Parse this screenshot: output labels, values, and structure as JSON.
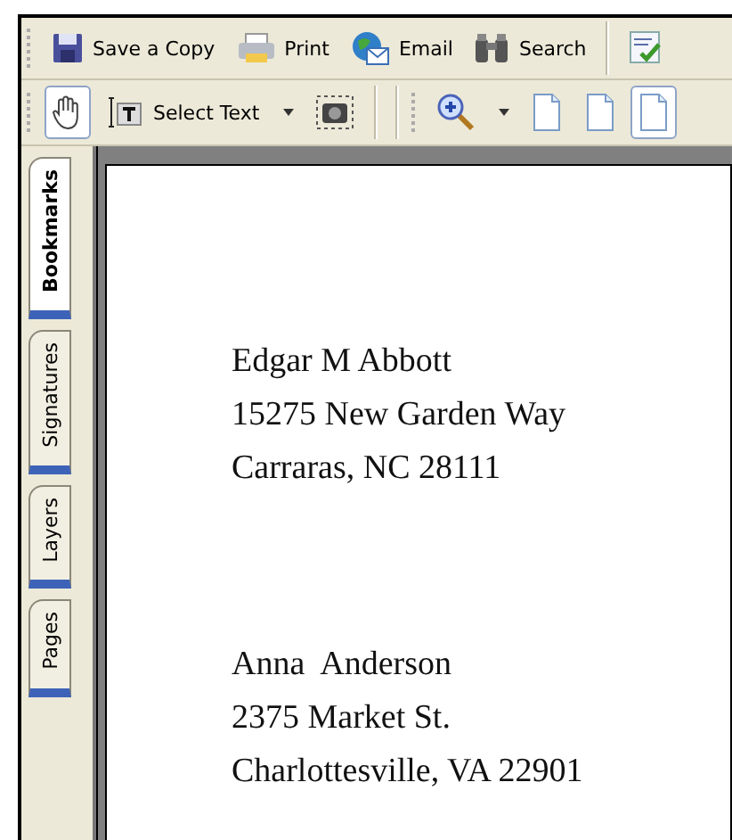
{
  "toolbar_top": {
    "buttons": [
      {
        "kind": "save",
        "label": "Save a Copy"
      },
      {
        "kind": "print",
        "label": "Print"
      },
      {
        "kind": "email",
        "label": "Email"
      },
      {
        "kind": "search",
        "label": "Search"
      },
      {
        "kind": "spell"
      }
    ]
  },
  "toolbar_bottom": {
    "tools": [
      {
        "kind": "hand",
        "selected": true
      },
      {
        "kind": "select",
        "label": "Select Text",
        "selected": false
      },
      {
        "kind": "snapshot",
        "selected": false
      },
      {
        "kind": "zoom",
        "selected": false
      },
      {
        "kind": "page",
        "selected": false
      },
      {
        "kind": "page",
        "selected": false
      },
      {
        "kind": "page",
        "selected": true
      }
    ]
  },
  "side_tabs": [
    {
      "label": "Bookmarks",
      "selected": true
    },
    {
      "label": "Signatures",
      "selected": false
    },
    {
      "label": "Layers",
      "selected": false
    },
    {
      "label": "Pages",
      "selected": false
    }
  ],
  "document": {
    "addresses": [
      [
        "Edgar M Abbott",
        "15275 New Garden Way",
        "Carraras, NC 28111"
      ],
      [
        "Anna  Anderson",
        "2375 Market St.",
        "Charlottesville, VA 22901"
      ]
    ]
  }
}
